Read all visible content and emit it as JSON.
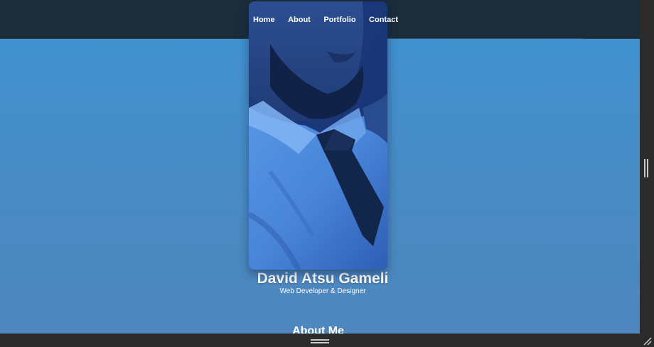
{
  "nav": {
    "items": [
      {
        "label": "Home"
      },
      {
        "label": "About"
      },
      {
        "label": "Portfolio"
      },
      {
        "label": "Contact"
      }
    ]
  },
  "profile": {
    "name": "David Atsu Gameli",
    "role": "Web Developer & Designer",
    "photo_icon": "profile-photo-icon"
  },
  "section": {
    "heading": "About Me"
  },
  "colors": {
    "nav_background": "#1b2c3a",
    "page_gradient_top": "#3f93d3",
    "page_gradient_bottom": "#4e86bd",
    "chrome": "#2b2b2b"
  }
}
